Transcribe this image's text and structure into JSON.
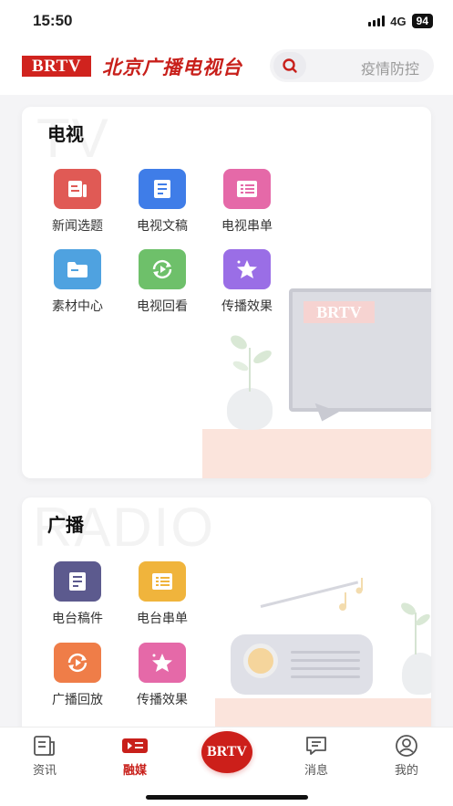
{
  "status_bar": {
    "time": "15:50",
    "network": "4G",
    "battery": "94"
  },
  "header": {
    "logo": "BRTV",
    "station_name": "北京广播电视台",
    "search_placeholder": "疫情防控"
  },
  "tv_section": {
    "title": "电视",
    "watermark": "TV",
    "screen_logo": "BRTV",
    "items": [
      {
        "label": "新闻选题",
        "icon": "news-topic-icon",
        "color": "#e05a55"
      },
      {
        "label": "电视文稿",
        "icon": "document-icon",
        "color": "#3f7de8"
      },
      {
        "label": "电视串单",
        "icon": "list-icon",
        "color": "#e569a8"
      },
      {
        "label": "素材中心",
        "icon": "folder-icon",
        "color": "#4fa2e0"
      },
      {
        "label": "电视回看",
        "icon": "replay-icon",
        "color": "#6ec06a"
      },
      {
        "label": "传播效果",
        "icon": "star-icon",
        "color": "#9a6ee6"
      }
    ]
  },
  "radio_section": {
    "title": "广播",
    "watermark": "RADIO",
    "items": [
      {
        "label": "电台稿件",
        "icon": "document-icon",
        "color": "#5c5a8e"
      },
      {
        "label": "电台串单",
        "icon": "list-icon",
        "color": "#f0b43c"
      },
      {
        "label": "广播回放",
        "icon": "replay-icon",
        "color": "#ef7d48"
      },
      {
        "label": "传播效果",
        "icon": "star-icon",
        "color": "#e569a8"
      }
    ]
  },
  "bottom_nav": {
    "items": [
      {
        "label": "资讯",
        "icon": "news-icon",
        "active": false
      },
      {
        "label": "融媒",
        "icon": "media-icon",
        "active": true
      },
      {
        "label": "BRTV",
        "icon": "brtv-logo",
        "active": false
      },
      {
        "label": "消息",
        "icon": "message-icon",
        "active": false
      },
      {
        "label": "我的",
        "icon": "profile-icon",
        "active": false
      }
    ]
  },
  "colors": {
    "brand_red": "#c8201b",
    "background": "#f4f4f6"
  }
}
